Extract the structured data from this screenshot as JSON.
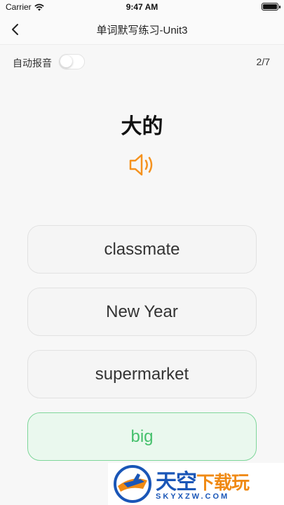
{
  "status_bar": {
    "carrier": "Carrier",
    "time": "9:47 AM",
    "wifi_icon": "wifi-icon",
    "battery_icon": "battery-icon",
    "battery_level": 1.0
  },
  "nav": {
    "back_icon": "chevron-left-icon",
    "title": "单词默写练习-Unit3"
  },
  "controls": {
    "auto_read_label": "自动报音",
    "auto_read_enabled": false,
    "progress": "2/7"
  },
  "question": {
    "word": "大的",
    "speaker_icon": "speaker-icon",
    "speaker_color": "#f5921e"
  },
  "options": [
    {
      "label": "classmate",
      "state": "default"
    },
    {
      "label": "New Year",
      "state": "default"
    },
    {
      "label": "supermarket",
      "state": "default"
    },
    {
      "label": "big",
      "state": "correct"
    }
  ],
  "colors": {
    "correct_text": "#45c06c",
    "correct_border": "#7fd69a",
    "correct_bg": "#eaf8ee"
  },
  "watermark": {
    "title_main": "天空",
    "title_accent": "下载玩",
    "subtitle": "SKYXZW.COM"
  }
}
